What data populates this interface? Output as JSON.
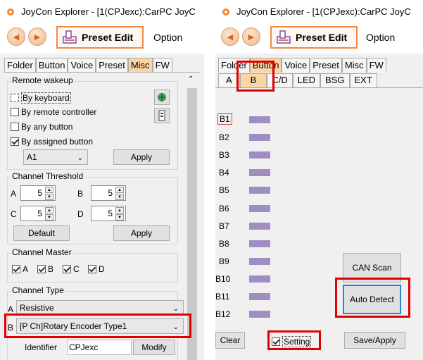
{
  "window": {
    "title": "JoyCon Explorer - [1(CPJexc):CarPC JoyC"
  },
  "toolbar": {
    "preset_edit": "Preset Edit",
    "option": "Option"
  },
  "main_tabs": [
    "Folder",
    "Button",
    "Voice",
    "Preset",
    "Misc",
    "FW"
  ],
  "misc": {
    "remote_wakeup": {
      "title": "Remote wakeup",
      "options": [
        {
          "label": "By keyboard",
          "checked": false
        },
        {
          "label": "By remote controller",
          "checked": false
        },
        {
          "label": "By any button",
          "checked": false
        },
        {
          "label": "By assigned button",
          "checked": true
        }
      ],
      "assigned_value": "A1",
      "apply": "Apply"
    },
    "channel_threshold": {
      "title": "Channel Threshold",
      "a_label": "A",
      "a_value": "5",
      "b_label": "B",
      "b_value": "5",
      "c_label": "C",
      "c_value": "5",
      "d_label": "D",
      "d_value": "5",
      "default": "Default",
      "apply": "Apply"
    },
    "channel_master": {
      "title": "Channel Master",
      "items": [
        {
          "label": "A",
          "checked": true
        },
        {
          "label": "B",
          "checked": true
        },
        {
          "label": "C",
          "checked": true
        },
        {
          "label": "D",
          "checked": true
        }
      ]
    },
    "channel_type": {
      "title": "Channel Type",
      "a_label": "A",
      "a_value": "Resistive",
      "b_label": "B",
      "b_value": "[P Ch]Rotary Encoder Type1"
    },
    "identifier": {
      "label": "Identifier",
      "value": "CPJexc",
      "modify": "Modify"
    }
  },
  "button_panel": {
    "sub_tabs": [
      "A",
      "B",
      "C/D",
      "LED",
      "BSG",
      "EXT"
    ],
    "buttons": [
      "B1",
      "B2",
      "B3",
      "B4",
      "B5",
      "B6",
      "B7",
      "B8",
      "B9",
      "B10",
      "B11",
      "B12"
    ],
    "can_scan": "CAN Scan",
    "auto_detect": "Auto Detect",
    "clear": "Clear",
    "setting": {
      "label": "Setting",
      "checked": true
    },
    "save_apply": "Save/Apply"
  },
  "colors": {
    "accent": "#f28a44",
    "highlight": "#e00000",
    "bar": "#9f8ec4",
    "active_tab": "#fcd5a6"
  }
}
